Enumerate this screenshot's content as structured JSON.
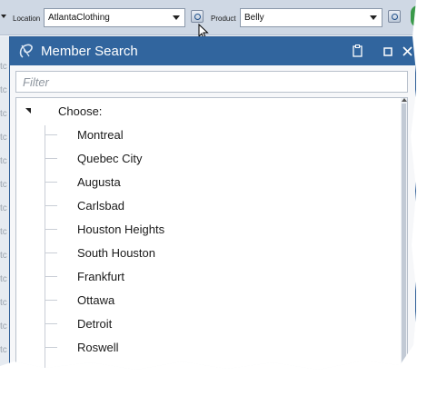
{
  "toolbar": {
    "location_label": "Location",
    "location_value": "AtlantaClothing",
    "product_label": "Product",
    "product_value": "Belly"
  },
  "background_cells": [
    "tc",
    "tc",
    "tc",
    "tc",
    "tc",
    "tc",
    "tc",
    "tc",
    "tc",
    "tc",
    "tc",
    "tc",
    "tc",
    "tc"
  ],
  "dialog": {
    "title": "Member Search",
    "filter_placeholder": "Filter",
    "root_label": "Choose:",
    "items": [
      "Montreal",
      "Quebec City",
      "Augusta",
      "Carlsbad",
      "Houston Heights",
      "South Houston",
      "Frankfurt",
      "Ottawa",
      "Detroit",
      "Roswell"
    ]
  },
  "colors": {
    "titlebar": "#31659e",
    "toolbar": "#cfd8e4"
  }
}
